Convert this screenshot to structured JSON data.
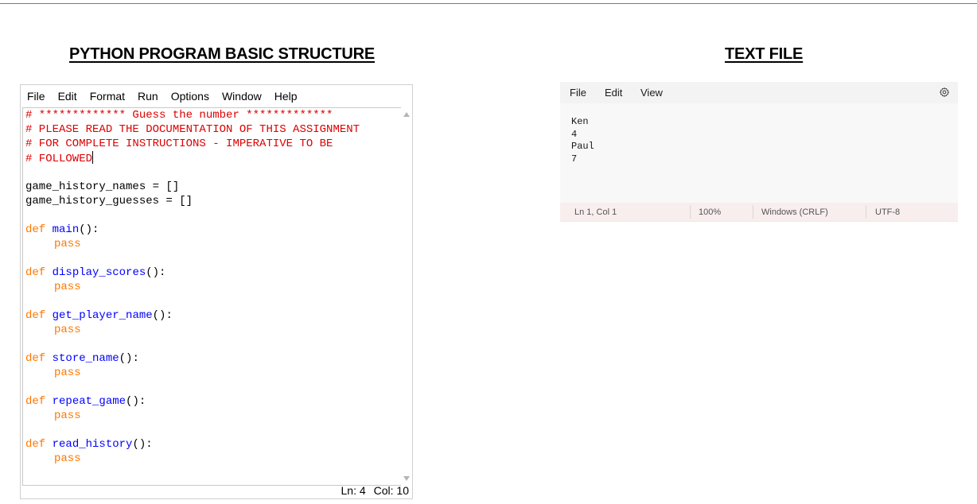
{
  "headings": {
    "left": "PYTHON PROGRAM BASIC STRUCTURE",
    "right": "TEXT FILE"
  },
  "idle": {
    "menu": [
      "File",
      "Edit",
      "Format",
      "Run",
      "Options",
      "Window",
      "Help"
    ],
    "code": {
      "comment1": "# ************* Guess the number *************",
      "comment2": "# PLEASE READ THE DOCUMENTATION OF THIS ASSIGNMENT",
      "comment3": "# FOR COMPLETE INSTRUCTIONS - IMPERATIVE TO BE",
      "comment4": "# FOLLOWED",
      "var1": "game_history_names = []",
      "var2": "game_history_guesses = []",
      "def_kw": "def",
      "pass_kw": "pass",
      "functions": [
        "main",
        "display_scores",
        "get_player_name",
        "store_name",
        "repeat_game",
        "read_history"
      ],
      "paren": "():"
    },
    "status": {
      "line": "Ln: 4",
      "col": "Col: 10"
    }
  },
  "notepad": {
    "menu": [
      "File",
      "Edit",
      "View"
    ],
    "content": "Ken\n4\nPaul\n7",
    "status": {
      "position": "Ln 1, Col 1",
      "zoom": "100%",
      "line_ending": "Windows (CRLF)",
      "encoding": "UTF-8"
    },
    "settings_icon": "gear-icon"
  }
}
